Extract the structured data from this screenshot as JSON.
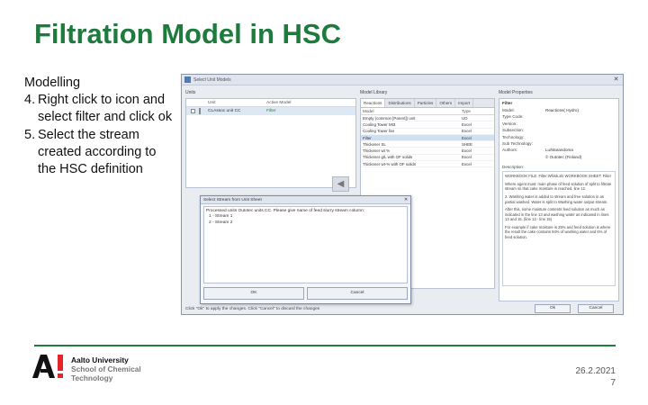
{
  "slide": {
    "title": "Filtration Model in HSC",
    "steps_heading": "Modelling",
    "steps": [
      {
        "num": "4.",
        "text": "Right click to icon and select filter and click ok"
      },
      {
        "num": "5.",
        "text": "Select the stream created according to the HSC definition"
      }
    ]
  },
  "window": {
    "title": "Select Unit Models",
    "close_icon": "close-icon",
    "units_label": "Units",
    "units_columns": [
      "Unit",
      "Active Model"
    ],
    "units_rows": [
      {
        "unit": "CLAssoc unit CC",
        "active_model": "Filter"
      }
    ],
    "library_label": "Model Library",
    "library_tabs": [
      "Reactions",
      "Distributions",
      "Particles",
      "Others",
      "Import"
    ],
    "library_columns": [
      "Model",
      "Type"
    ],
    "library_rows": [
      {
        "model": "Empty (common [Parent]) unit",
        "type": "UO"
      },
      {
        "model": "Cooling Tower Mt3",
        "type": "Excel"
      },
      {
        "model": "Cooling Tower fan",
        "type": "Excel"
      },
      {
        "model": "Filter",
        "type": "Excel"
      },
      {
        "model": "Thickener SL",
        "type": "SHEE"
      },
      {
        "model": "Thickener wt %",
        "type": "Excel"
      },
      {
        "model": "Thickener g/L with OF solids",
        "type": "Excel"
      },
      {
        "model": "Thickener wt-% with OF solids",
        "type": "Excel"
      }
    ],
    "arrow_icon": "arrow-left-icon",
    "props_label": "Model Properties",
    "props_title": "Filter",
    "props": [
      {
        "k": "Model:",
        "v": "Reactions( Hydro)"
      },
      {
        "k": "Type Code:",
        "v": ""
      },
      {
        "k": "Version:",
        "v": ""
      },
      {
        "k": "Subsection:",
        "v": ""
      },
      {
        "k": "Technology:",
        "v": ""
      },
      {
        "k": "Sub Technology:",
        "v": ""
      },
      {
        "k": "Authors:",
        "v": "Lu/Marandoma"
      },
      {
        "k": "",
        "v": "© Outotec (Finland)"
      }
    ],
    "description_label": "Description:",
    "description": [
      "WORKBOOK FILE:  Filter.Whisk.xls  WORKBOOK SHEET:  Filter",
      "Where agent must: main phase of feed solution of split to filtrate stream so that cake moisture is reached, line 12.",
      "2. Washing water is added to stream and free solution in as partial washed. Water is split to Washing water output stream.",
      "After this, some moisture contents feed solution as much as indicated in the line 13 and washing water as indicated in lines 13 and 15. (line 13 - line 15)",
      "For example if cake moisture is 25% and feed solution is where the result the cake contains 94% of washing water and 6% of feed solution."
    ],
    "status_text": "Click \"Ok\" to apply the changes. Click \"Cancel\" to discard the changes",
    "ok_label": "Ok",
    "cancel_label": "Cancel"
  },
  "dialog": {
    "title": "Select Stream from Unit Sheet",
    "prompt": "Processed units Outotec units CC. Please give name of feed slurry stream column:",
    "items": [
      "1 - Stream 1",
      "2 - Stream 2"
    ],
    "ok_label": "OK",
    "cancel_label": "Cancel"
  },
  "footer": {
    "org_line1": "Aalto University",
    "org_line2": "School of Chemical",
    "org_line3": "Technology",
    "date": "26.2.2021",
    "page": "7"
  },
  "colors": {
    "brand_green": "#1f7a3e"
  }
}
